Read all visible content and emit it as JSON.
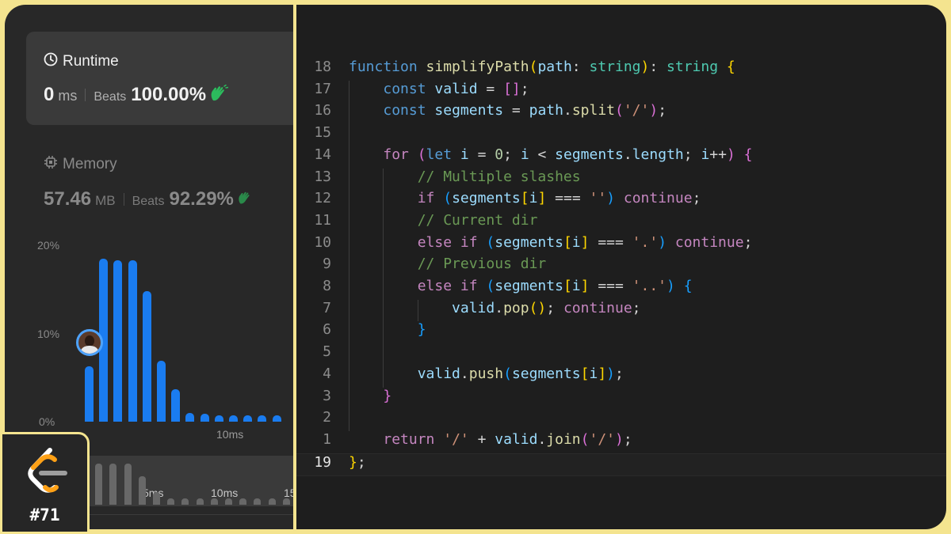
{
  "colors": {
    "frame": "#f4e48f",
    "panel_left": "#282828",
    "editor_bg": "#1e1e1e",
    "bar_accent": "#1a7cf0",
    "beats_hand": "#2cbb5d"
  },
  "runtime": {
    "title": "Runtime",
    "icon": "clock-icon",
    "value": "0",
    "unit": "ms",
    "beats_label": "Beats",
    "beats_pct": "100.00%"
  },
  "memory": {
    "title": "Memory",
    "icon": "chip-icon",
    "value": "57.46",
    "unit": "MB",
    "beats_label": "Beats",
    "beats_pct": "92.29%"
  },
  "chart_data": {
    "type": "bar",
    "y_ticks": [
      "20%",
      "10%",
      "0%"
    ],
    "ylim": [
      0,
      20
    ],
    "x_ticks": [
      "10ms"
    ],
    "values": [
      6.3,
      18.5,
      18.3,
      18.3,
      14.8,
      6.9,
      3.7,
      1.0,
      0.9,
      0.7,
      0.7,
      0.7,
      0.7,
      0.7
    ]
  },
  "scrubber": {
    "labels": [
      "5ms",
      "10ms",
      "15"
    ],
    "values": [
      100,
      100,
      100,
      100,
      70,
      30,
      15,
      15,
      15,
      15,
      15,
      15,
      15,
      15,
      15
    ]
  },
  "logo": {
    "icon": "leetcode-logo-icon",
    "number": "#71"
  },
  "code_lines": [
    {
      "num": "18",
      "tokens": [
        [
          "t-kw",
          "function"
        ],
        [
          "t-p",
          " "
        ],
        [
          "t-fn",
          "simplifyPath"
        ],
        [
          "t-br1",
          "("
        ],
        [
          "t-var",
          "path"
        ],
        [
          "t-p",
          ": "
        ],
        [
          "t-ty",
          "string"
        ],
        [
          "t-br1",
          ")"
        ],
        [
          "t-p",
          ": "
        ],
        [
          "t-ty",
          "string"
        ],
        [
          "t-p",
          " "
        ],
        [
          "t-br1",
          "{"
        ]
      ]
    },
    {
      "num": "17",
      "tokens": [
        [
          "t-p",
          "    "
        ],
        [
          "t-kw",
          "const"
        ],
        [
          "t-p",
          " "
        ],
        [
          "t-var",
          "valid"
        ],
        [
          "t-p",
          " = "
        ],
        [
          "t-br2",
          "[]"
        ],
        [
          "t-p",
          ";"
        ]
      ]
    },
    {
      "num": "16",
      "tokens": [
        [
          "t-p",
          "    "
        ],
        [
          "t-kw",
          "const"
        ],
        [
          "t-p",
          " "
        ],
        [
          "t-var",
          "segments"
        ],
        [
          "t-p",
          " = "
        ],
        [
          "t-var",
          "path"
        ],
        [
          "t-p",
          "."
        ],
        [
          "t-fn",
          "split"
        ],
        [
          "t-br2",
          "("
        ],
        [
          "t-str",
          "'/'"
        ],
        [
          "t-br2",
          ")"
        ],
        [
          "t-p",
          ";"
        ]
      ]
    },
    {
      "num": "15",
      "tokens": []
    },
    {
      "num": "14",
      "tokens": [
        [
          "t-p",
          "    "
        ],
        [
          "t-ctl",
          "for"
        ],
        [
          "t-p",
          " "
        ],
        [
          "t-br2",
          "("
        ],
        [
          "t-kw",
          "let"
        ],
        [
          "t-p",
          " "
        ],
        [
          "t-var",
          "i"
        ],
        [
          "t-p",
          " = "
        ],
        [
          "t-num",
          "0"
        ],
        [
          "t-p",
          "; "
        ],
        [
          "t-var",
          "i"
        ],
        [
          "t-p",
          " < "
        ],
        [
          "t-var",
          "segments"
        ],
        [
          "t-p",
          "."
        ],
        [
          "t-var",
          "length"
        ],
        [
          "t-p",
          "; "
        ],
        [
          "t-var",
          "i"
        ],
        [
          "t-p",
          "++"
        ],
        [
          "t-br2",
          ")"
        ],
        [
          "t-p",
          " "
        ],
        [
          "t-br2",
          "{"
        ]
      ]
    },
    {
      "num": "13",
      "tokens": [
        [
          "t-p",
          "        "
        ],
        [
          "t-com",
          "// Multiple slashes"
        ]
      ]
    },
    {
      "num": "12",
      "tokens": [
        [
          "t-p",
          "        "
        ],
        [
          "t-ctl",
          "if"
        ],
        [
          "t-p",
          " "
        ],
        [
          "t-br3",
          "("
        ],
        [
          "t-var",
          "segments"
        ],
        [
          "t-br1",
          "["
        ],
        [
          "t-var",
          "i"
        ],
        [
          "t-br1",
          "]"
        ],
        [
          "t-p",
          " === "
        ],
        [
          "t-str",
          "''"
        ],
        [
          "t-br3",
          ")"
        ],
        [
          "t-p",
          " "
        ],
        [
          "t-ctl",
          "continue"
        ],
        [
          "t-p",
          ";"
        ]
      ]
    },
    {
      "num": "11",
      "tokens": [
        [
          "t-p",
          "        "
        ],
        [
          "t-com",
          "// Current dir"
        ]
      ]
    },
    {
      "num": "10",
      "tokens": [
        [
          "t-p",
          "        "
        ],
        [
          "t-ctl",
          "else if"
        ],
        [
          "t-p",
          " "
        ],
        [
          "t-br3",
          "("
        ],
        [
          "t-var",
          "segments"
        ],
        [
          "t-br1",
          "["
        ],
        [
          "t-var",
          "i"
        ],
        [
          "t-br1",
          "]"
        ],
        [
          "t-p",
          " === "
        ],
        [
          "t-str",
          "'.'"
        ],
        [
          "t-br3",
          ")"
        ],
        [
          "t-p",
          " "
        ],
        [
          "t-ctl",
          "continue"
        ],
        [
          "t-p",
          ";"
        ]
      ]
    },
    {
      "num": "9",
      "tokens": [
        [
          "t-p",
          "        "
        ],
        [
          "t-com",
          "// Previous dir"
        ]
      ]
    },
    {
      "num": "8",
      "tokens": [
        [
          "t-p",
          "        "
        ],
        [
          "t-ctl",
          "else if"
        ],
        [
          "t-p",
          " "
        ],
        [
          "t-br3",
          "("
        ],
        [
          "t-var",
          "segments"
        ],
        [
          "t-br1",
          "["
        ],
        [
          "t-var",
          "i"
        ],
        [
          "t-br1",
          "]"
        ],
        [
          "t-p",
          " === "
        ],
        [
          "t-str",
          "'..'"
        ],
        [
          "t-br3",
          ")"
        ],
        [
          "t-p",
          " "
        ],
        [
          "t-br3",
          "{"
        ]
      ]
    },
    {
      "num": "7",
      "tokens": [
        [
          "t-p",
          "            "
        ],
        [
          "t-var",
          "valid"
        ],
        [
          "t-p",
          "."
        ],
        [
          "t-fn",
          "pop"
        ],
        [
          "t-br1",
          "()"
        ],
        [
          "t-p",
          "; "
        ],
        [
          "t-ctl",
          "continue"
        ],
        [
          "t-p",
          ";"
        ]
      ]
    },
    {
      "num": "6",
      "tokens": [
        [
          "t-p",
          "        "
        ],
        [
          "t-br3",
          "}"
        ]
      ]
    },
    {
      "num": "5",
      "tokens": []
    },
    {
      "num": "4",
      "tokens": [
        [
          "t-p",
          "        "
        ],
        [
          "t-var",
          "valid"
        ],
        [
          "t-p",
          "."
        ],
        [
          "t-fn",
          "push"
        ],
        [
          "t-br3",
          "("
        ],
        [
          "t-var",
          "segments"
        ],
        [
          "t-br1",
          "["
        ],
        [
          "t-var",
          "i"
        ],
        [
          "t-br1",
          "]"
        ],
        [
          "t-br3",
          ")"
        ],
        [
          "t-p",
          ";"
        ]
      ]
    },
    {
      "num": "3",
      "tokens": [
        [
          "t-p",
          "    "
        ],
        [
          "t-br2",
          "}"
        ]
      ]
    },
    {
      "num": "2",
      "tokens": []
    },
    {
      "num": "1",
      "tokens": [
        [
          "t-p",
          "    "
        ],
        [
          "t-ctl",
          "return"
        ],
        [
          "t-p",
          " "
        ],
        [
          "t-str",
          "'/'"
        ],
        [
          "t-p",
          " + "
        ],
        [
          "t-var",
          "valid"
        ],
        [
          "t-p",
          "."
        ],
        [
          "t-fn",
          "join"
        ],
        [
          "t-br2",
          "("
        ],
        [
          "t-str",
          "'/'"
        ],
        [
          "t-br2",
          ")"
        ],
        [
          "t-p",
          ";"
        ]
      ]
    },
    {
      "num": "19",
      "current": true,
      "tokens": [
        [
          "t-br1",
          "}"
        ],
        [
          "t-p",
          ";"
        ]
      ]
    }
  ]
}
